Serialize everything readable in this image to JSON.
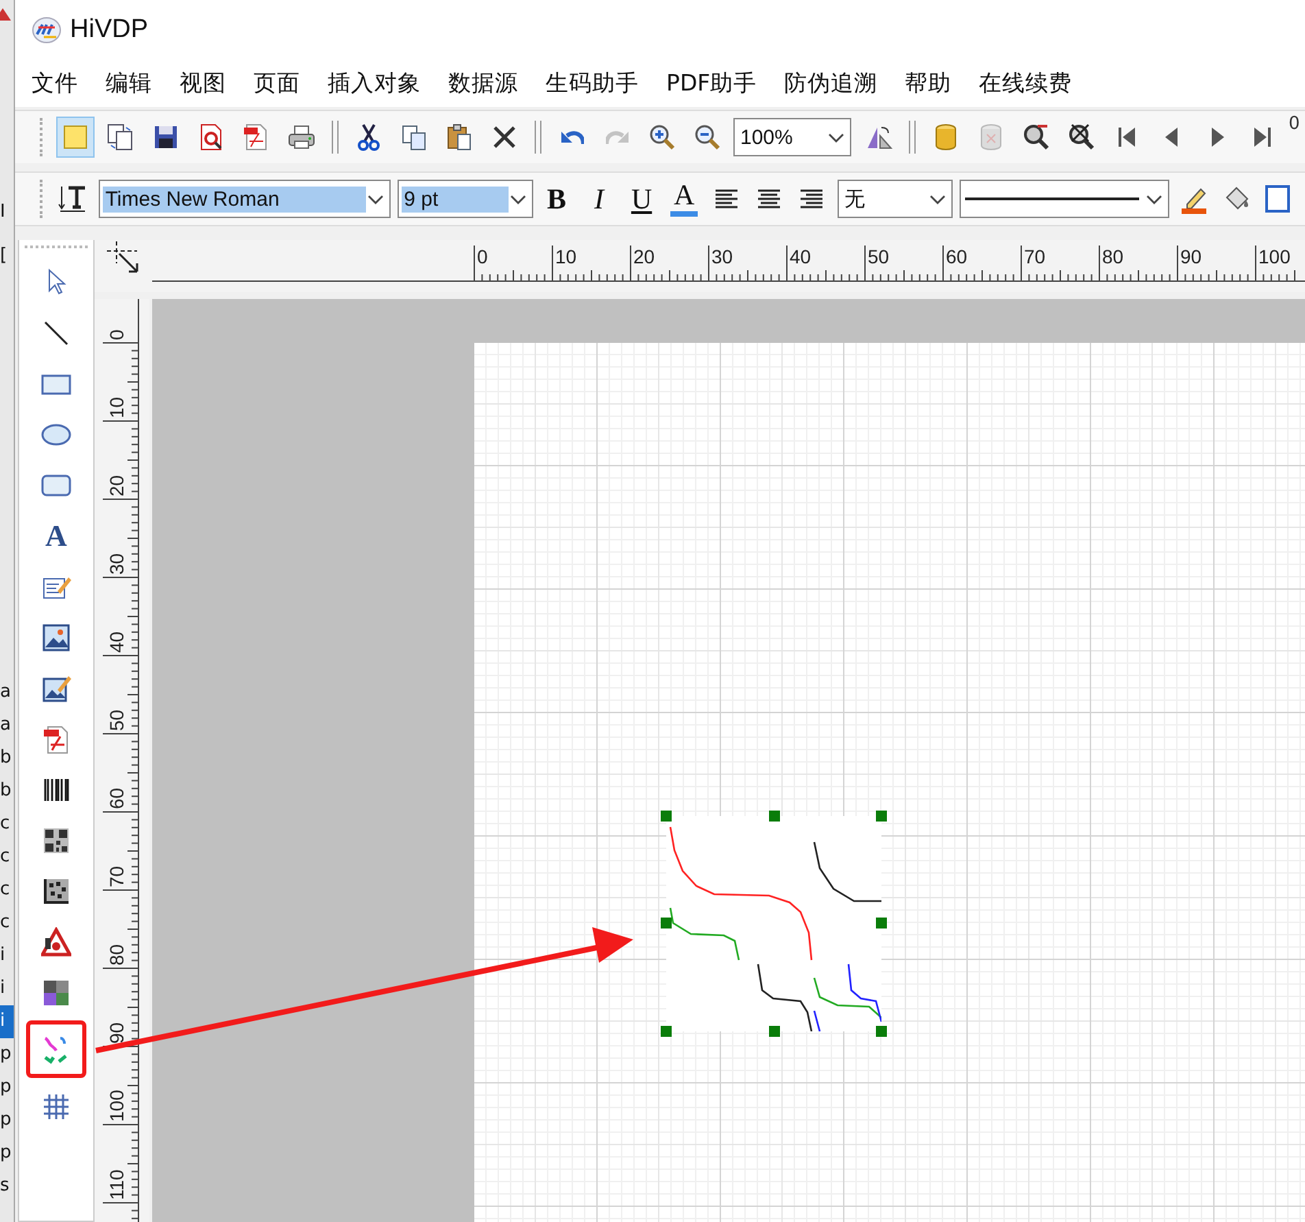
{
  "background_window": {
    "fragments": [
      "I",
      "["
    ],
    "letters": [
      {
        "text": "a",
        "selected": false
      },
      {
        "text": "a",
        "selected": false
      },
      {
        "text": "b",
        "selected": false
      },
      {
        "text": "b",
        "selected": false
      },
      {
        "text": "c",
        "selected": false
      },
      {
        "text": "c",
        "selected": false
      },
      {
        "text": "c",
        "selected": false
      },
      {
        "text": "c",
        "selected": false
      },
      {
        "text": "i",
        "selected": false
      },
      {
        "text": "i",
        "selected": false
      },
      {
        "text": "i",
        "selected": true
      },
      {
        "text": "p",
        "selected": false
      },
      {
        "text": "p",
        "selected": false
      },
      {
        "text": "p",
        "selected": false
      },
      {
        "text": "p",
        "selected": false
      },
      {
        "text": "s",
        "selected": false
      }
    ]
  },
  "window": {
    "title": "HiVDP"
  },
  "menu": [
    "文件",
    "编辑",
    "视图",
    "页面",
    "插入对象",
    "数据源",
    "生码助手",
    "PDF助手",
    "防伪追溯",
    "帮助",
    "在线续费"
  ],
  "main_toolbar": {
    "items": [
      {
        "kind": "button",
        "selected": true,
        "disabled": false
      },
      {
        "kind": "button",
        "selected": false,
        "disabled": false
      },
      {
        "kind": "button",
        "selected": false,
        "disabled": false
      },
      {
        "kind": "button",
        "selected": false,
        "disabled": false
      },
      {
        "kind": "button",
        "selected": false,
        "disabled": false
      },
      {
        "kind": "button",
        "selected": false,
        "disabled": false
      },
      {
        "kind": "separator"
      },
      {
        "kind": "button",
        "selected": false,
        "disabled": false
      },
      {
        "kind": "button",
        "selected": false,
        "disabled": false
      },
      {
        "kind": "button",
        "selected": false,
        "disabled": false
      },
      {
        "kind": "button",
        "selected": false,
        "disabled": false
      },
      {
        "kind": "separator"
      },
      {
        "kind": "button",
        "selected": false,
        "disabled": false
      },
      {
        "kind": "button",
        "selected": false,
        "disabled": true
      },
      {
        "kind": "button",
        "selected": false,
        "disabled": false
      },
      {
        "kind": "button",
        "selected": false,
        "disabled": false
      },
      {
        "kind": "combo",
        "value": "100%"
      },
      {
        "kind": "button",
        "selected": false,
        "disabled": false
      },
      {
        "kind": "separator"
      },
      {
        "kind": "button",
        "selected": false,
        "disabled": false
      },
      {
        "kind": "button",
        "selected": false,
        "disabled": true
      },
      {
        "kind": "button",
        "selected": false,
        "disabled": false
      },
      {
        "kind": "button",
        "selected": false,
        "disabled": false
      },
      {
        "kind": "button",
        "selected": false,
        "disabled": false
      },
      {
        "kind": "button",
        "selected": false,
        "disabled": false
      },
      {
        "kind": "button",
        "selected": false,
        "disabled": false
      },
      {
        "kind": "button",
        "selected": false,
        "disabled": false
      }
    ],
    "counter": "0"
  },
  "format_toolbar": {
    "items": [
      {
        "kind": "icon"
      },
      {
        "kind": "combo",
        "value": "Times New Roman",
        "selected": true
      },
      {
        "kind": "combo",
        "value": "9 pt",
        "selected": true
      },
      {
        "kind": "glyph",
        "label": "B"
      },
      {
        "kind": "glyph",
        "label": "I"
      },
      {
        "kind": "glyph",
        "label": "U"
      },
      {
        "kind": "glyph",
        "label": "A",
        "color": "#3c8ce6"
      },
      {
        "kind": "icon"
      },
      {
        "kind": "icon"
      },
      {
        "kind": "icon"
      },
      {
        "kind": "combo",
        "value": "无",
        "selected": false
      },
      {
        "kind": "line_combo"
      },
      {
        "kind": "icon"
      },
      {
        "kind": "icon"
      },
      {
        "kind": "icon"
      }
    ]
  },
  "drawing_tools": [
    {
      "highlighted": false
    },
    {
      "highlighted": false
    },
    {
      "highlighted": false
    },
    {
      "highlighted": false
    },
    {
      "highlighted": false
    },
    {
      "label": "A",
      "highlighted": false
    },
    {
      "highlighted": false
    },
    {
      "highlighted": false
    },
    {
      "highlighted": false
    },
    {
      "highlighted": false
    },
    {
      "highlighted": false
    },
    {
      "highlighted": false
    },
    {
      "highlighted": false
    },
    {
      "highlighted": false
    },
    {
      "highlighted": false
    },
    {
      "highlighted": true
    },
    {
      "highlighted": false
    }
  ],
  "horizontal_ruler": {
    "labels": [
      "0",
      "10",
      "20",
      "30",
      "40",
      "50",
      "60",
      "70",
      "80",
      "90",
      "100"
    ]
  },
  "vertical_ruler": {
    "labels": [
      "0",
      "10",
      "20",
      "30",
      "40",
      "50",
      "60",
      "70",
      "80",
      "90",
      "100",
      "110"
    ]
  },
  "canvas": {
    "object": {
      "selected": true
    }
  },
  "annotation": {
    "arrow": true
  }
}
